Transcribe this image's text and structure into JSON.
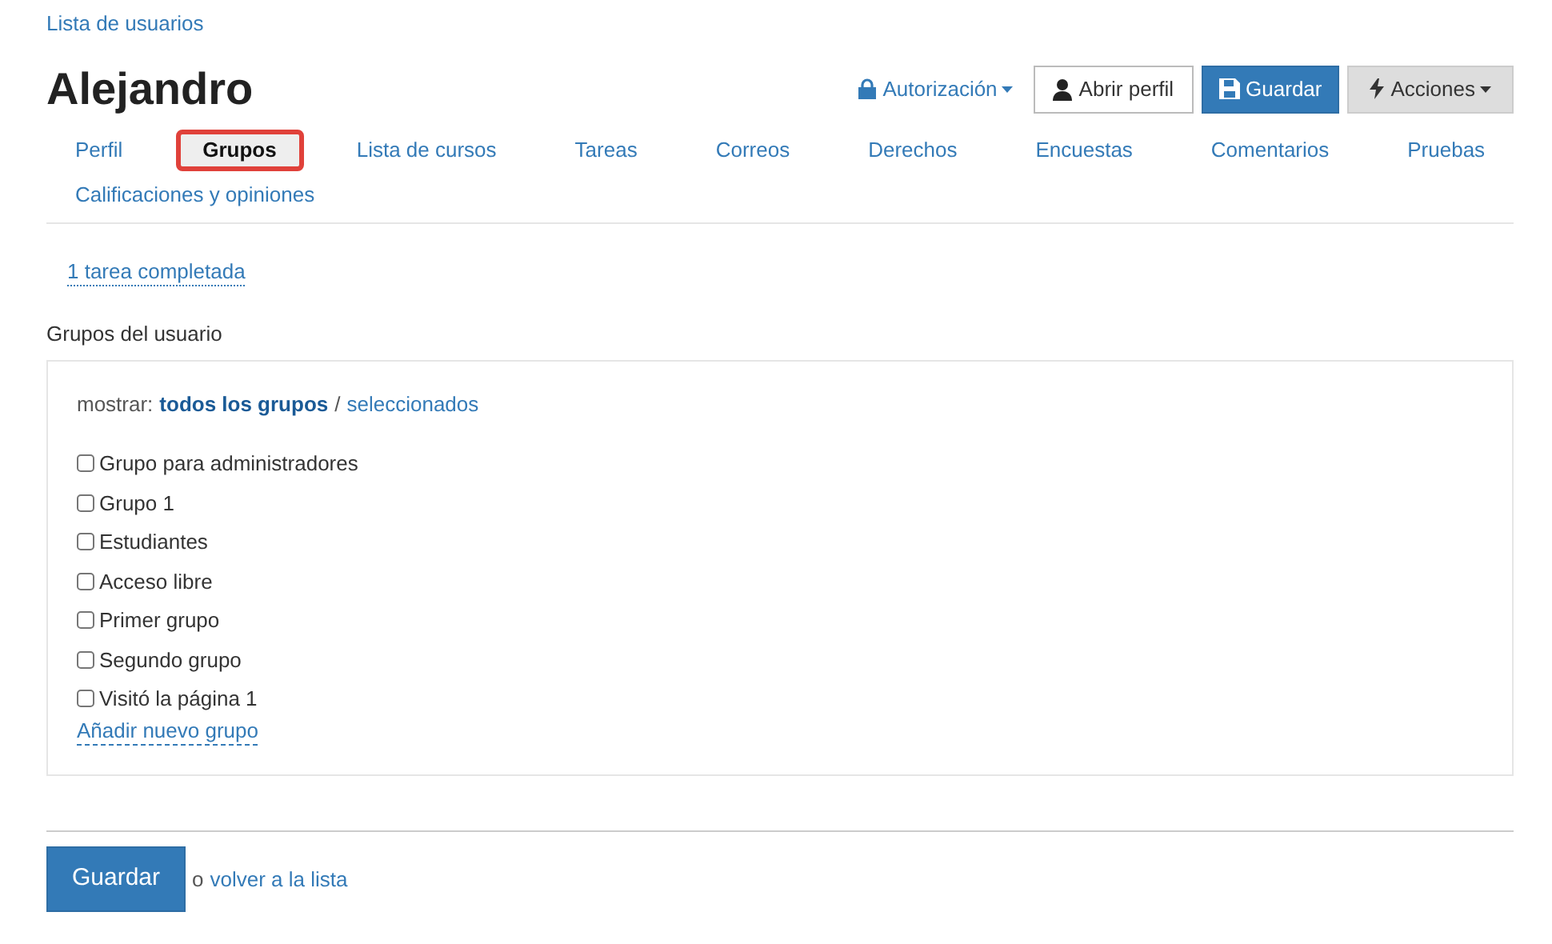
{
  "breadcrumb": "Lista de usuarios",
  "title": "Alejandro",
  "actions": [
    {
      "kind": "link",
      "label": "Autorización"
    },
    {
      "kind": "outline",
      "label": "Abrir perfil"
    },
    {
      "kind": "primary",
      "label": "Guardar"
    },
    {
      "kind": "gray",
      "label": "Acciones"
    }
  ],
  "tabs": [
    {
      "label": "Perfil",
      "selected": false
    },
    {
      "label": "Grupos",
      "selected": true
    },
    {
      "label": "Lista de cursos",
      "selected": false
    },
    {
      "label": "Tareas",
      "selected": false
    },
    {
      "label": "Correos",
      "selected": false
    },
    {
      "label": "Derechos",
      "selected": false
    },
    {
      "label": "Encuestas",
      "selected": false
    },
    {
      "label": "Comentarios",
      "selected": false
    },
    {
      "label": "Pruebas",
      "selected": false
    },
    {
      "label": "Calificaciones y opiniones",
      "selected": false
    }
  ],
  "task_link": "1 tarea completada",
  "groups": {
    "heading": "Grupos del usuario",
    "filter_label": "mostrar:",
    "filter_separator": "/",
    "filters": [
      {
        "label": "todos los grupos",
        "selected": true
      },
      {
        "label": "seleccionados",
        "selected": false
      }
    ],
    "items": [
      {
        "label": "Grupo para administradores",
        "checked": false
      },
      {
        "label": "Grupo 1",
        "checked": false
      },
      {
        "label": "Estudiantes",
        "checked": false
      },
      {
        "label": "Acceso libre",
        "checked": false
      },
      {
        "label": "Primer grupo",
        "checked": false
      },
      {
        "label": "Segundo grupo",
        "checked": false
      },
      {
        "label": "Visitó la página 1",
        "checked": false
      }
    ],
    "add_link": "Añadir nuevo grupo"
  },
  "footer": {
    "save": "Guardar",
    "prefix": "o",
    "back_link": "volver a la lista"
  }
}
